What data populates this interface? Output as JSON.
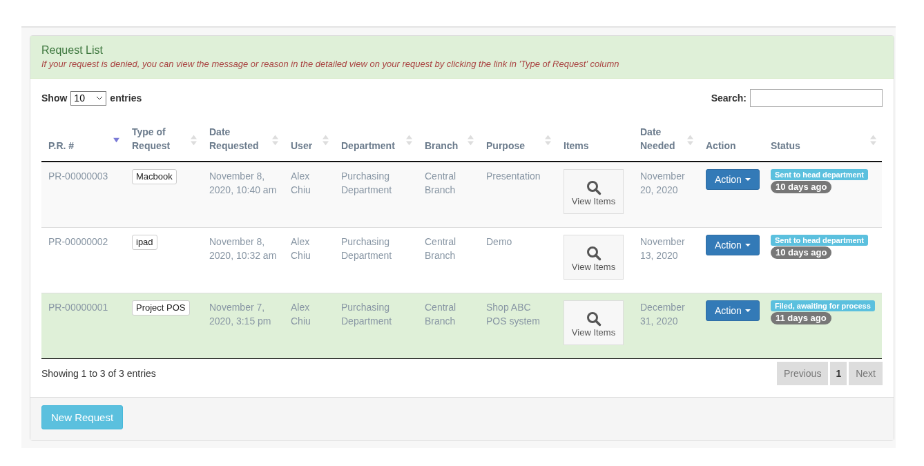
{
  "panel": {
    "title": "Request List",
    "note": "If your request is denied, you can view the message or reason in the detailed view on your request by clicking the link in 'Type of Request' column"
  },
  "length_menu": {
    "label_before": "Show",
    "value": "10",
    "label_after": "entries"
  },
  "search": {
    "label": "Search:"
  },
  "table": {
    "columns": [
      {
        "label": "P.R. #",
        "sortable": true,
        "sorted_descending": true
      },
      {
        "label": "Type of Request",
        "sortable": true,
        "sorted_descending": false
      },
      {
        "label": "Date Requested",
        "sortable": true,
        "sorted_descending": false
      },
      {
        "label": "User",
        "sortable": true,
        "sorted_descending": false
      },
      {
        "label": "Department",
        "sortable": true,
        "sorted_descending": false
      },
      {
        "label": "Branch",
        "sortable": true,
        "sorted_descending": false
      },
      {
        "label": "Purpose",
        "sortable": true,
        "sorted_descending": false
      },
      {
        "label": "Items",
        "sortable": false,
        "sorted_descending": false
      },
      {
        "label": "Date Needed",
        "sortable": true,
        "sorted_descending": false
      },
      {
        "label": "Action",
        "sortable": false,
        "sorted_descending": false
      },
      {
        "label": "Status",
        "sortable": true,
        "sorted_descending": false
      }
    ],
    "rows": [
      {
        "pr": "PR-00000003",
        "type": "Macbook",
        "date_requested": "November 8, 2020, 10:40 am",
        "user": "Alex Chiu",
        "department": "Purchasing Department",
        "branch": "Central Branch",
        "purpose": "Presentation",
        "items_button": "View Items",
        "date_needed": "November 20, 2020",
        "action": "Action",
        "status": "Sent to head department",
        "age": "10 days ago",
        "selected": false
      },
      {
        "pr": "PR-00000002",
        "type": "ipad",
        "date_requested": "November 8, 2020, 10:32 am",
        "user": "Alex Chiu",
        "department": "Purchasing Department",
        "branch": "Central Branch",
        "purpose": "Demo",
        "items_button": "View Items",
        "date_needed": "November 13, 2020",
        "action": "Action",
        "status": "Sent to head department",
        "age": "10 days ago",
        "selected": false
      },
      {
        "pr": "PR-00000001",
        "type": "Project POS",
        "date_requested": "November 7, 2020, 3:15 pm",
        "user": "Alex Chiu",
        "department": "Purchasing Department",
        "branch": "Central Branch",
        "purpose": "Shop ABC POS system",
        "items_button": "View Items",
        "date_needed": "December 31, 2020",
        "action": "Action",
        "status": "Filed, awaiting for process",
        "age": "11 days ago",
        "selected": true
      }
    ]
  },
  "info": "Showing 1 to 3 of 3 entries",
  "pagination": [
    {
      "label": "Previous",
      "kind": "nav",
      "disabled": true,
      "selected": false
    },
    {
      "label": "1",
      "kind": "page",
      "disabled": false,
      "selected": true
    },
    {
      "label": "Next",
      "kind": "nav",
      "disabled": true,
      "selected": false
    }
  ],
  "footer_button": "New Request"
}
